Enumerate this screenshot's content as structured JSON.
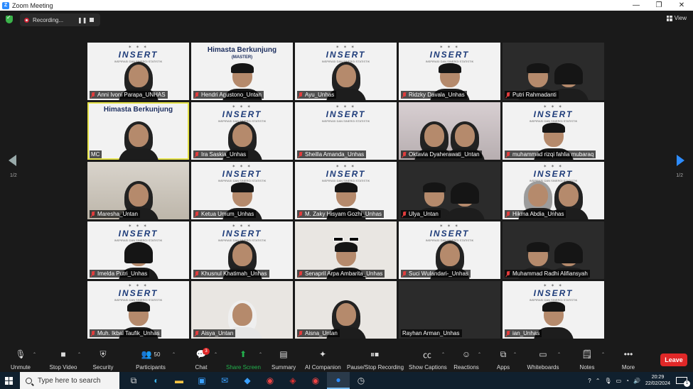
{
  "window": {
    "title": "Zoom Meeting",
    "controls": [
      "—",
      "❐",
      "✕"
    ]
  },
  "recording": {
    "label": "Recording...",
    "pause_glyph": "❚❚"
  },
  "view_button": {
    "label": "View"
  },
  "pagination": {
    "left": "1/2",
    "right": "1/2"
  },
  "tile_content": {
    "insert_logos": "✶ ✶ ✶",
    "insert_banner": "INSERT",
    "insert_sub": "INSPIRASI DAN SINERGI STATISTIK",
    "hb_title": "Himasta Berkunjung",
    "hb_master": "(MASTER)"
  },
  "participants": [
    {
      "name": "Anni Ivoni Parapa_UNHAS",
      "muted": true,
      "bg": "insert",
      "figure": "hijab-dark"
    },
    {
      "name": "Hendri Agustono_Untan",
      "muted": true,
      "bg": "himasta",
      "figure": "man"
    },
    {
      "name": "Ayu_Unhas",
      "muted": true,
      "bg": "insert",
      "figure": "hijab-dark"
    },
    {
      "name": "Ridzky Davala_Unhas",
      "muted": true,
      "bg": "insert",
      "figure": "man"
    },
    {
      "name": "Putri Rahmadanti",
      "muted": true,
      "bg": "dark",
      "figure": "two"
    },
    {
      "name": "MC",
      "muted": false,
      "bg": "himasta-active",
      "figure": "hijab-dark"
    },
    {
      "name": "Ira Saskia_Unhas",
      "muted": true,
      "bg": "insert",
      "figure": "hijab-dark"
    },
    {
      "name": "Sheilla Amanda_Unhas",
      "muted": true,
      "bg": "insert",
      "figure": "none"
    },
    {
      "name": "Oktavia Dyaherawati_Untan",
      "muted": true,
      "bg": "pink",
      "figure": "two-hijab"
    },
    {
      "name": "muhammad rizqi fahlia mubaraq",
      "muted": true,
      "bg": "insert",
      "figure": "man"
    },
    {
      "name": "Maresha_Untan",
      "muted": true,
      "bg": "room",
      "figure": "hijab-dark"
    },
    {
      "name": "Ketua Umum_Unhas",
      "muted": true,
      "bg": "insert",
      "figure": "man"
    },
    {
      "name": "M. Zaky Hisyam Gozhi_Unhas",
      "muted": true,
      "bg": "insert",
      "figure": "man"
    },
    {
      "name": "Ulya_Untan",
      "muted": true,
      "bg": "dark",
      "figure": "two"
    },
    {
      "name": "Hikma Abdia_Unhas",
      "muted": true,
      "bg": "insert",
      "figure": "two-hijab"
    },
    {
      "name": "Imelda Putri_Unhas",
      "muted": true,
      "bg": "insert",
      "figure": "woman"
    },
    {
      "name": "Khusnul Khatimah_Unhas",
      "muted": true,
      "bg": "insert",
      "figure": "hijab-dark"
    },
    {
      "name": "Senapril Arpa Ambarita_Unhas",
      "muted": true,
      "bg": "light",
      "figure": "sunglasses"
    },
    {
      "name": "Suci Wulandari-_Unhas",
      "muted": true,
      "bg": "insert",
      "figure": "hijab-dark"
    },
    {
      "name": "Muhammad Radhi Alifiansyah",
      "muted": true,
      "bg": "dark",
      "figure": "two"
    },
    {
      "name": "Muh. Ikbal Taufik_Unhas",
      "muted": true,
      "bg": "insert",
      "figure": "man"
    },
    {
      "name": "Aisya_Untan",
      "muted": true,
      "bg": "light",
      "figure": "hijab-white"
    },
    {
      "name": "Aisna_Untan",
      "muted": true,
      "bg": "light",
      "figure": "hijab-dark"
    },
    {
      "name": "Rayhan Arman_Unhas",
      "muted": false,
      "bg": "dark",
      "figure": "none"
    },
    {
      "name": "ian_Unhas",
      "muted": true,
      "bg": "insert",
      "figure": "man"
    }
  ],
  "toolbar": {
    "unmute": "Unmute",
    "stop_video": "Stop Video",
    "security": "Security",
    "participants": "Participants",
    "participants_count": "50",
    "chat": "Chat",
    "chat_badge": "3",
    "share_screen": "Share Screen",
    "summary": "Summary",
    "ai_companion": "AI Companion",
    "pause_stop_recording": "Pause/Stop Recording",
    "show_captions": "Show Captions",
    "reactions": "Reactions",
    "apps": "Apps",
    "whiteboards": "Whiteboards",
    "notes": "Notes",
    "more": "More",
    "leave": "Leave",
    "caret": "⌃"
  },
  "taskbar": {
    "search_placeholder": "Type here to search",
    "time": "20:29",
    "date": "22/02/2024",
    "notif_count": "1"
  },
  "colors": {
    "accent": "#2d8cff",
    "leave": "#e02828",
    "share": "#23b14d",
    "active_border": "#e6e34a",
    "muted_mic": "#e13d3d"
  },
  "icons": {
    "unmute": "mic-off-icon",
    "stop_video": "camera-icon",
    "security": "shield-icon",
    "participants": "people-icon",
    "chat": "chat-icon",
    "share_screen": "share-icon",
    "summary": "document-icon",
    "ai_companion": "sparkle-icon",
    "recording": "pause-stop-icon",
    "captions": "cc-icon",
    "reactions": "smiley-icon",
    "apps": "apps-icon",
    "whiteboards": "whiteboard-icon",
    "notes": "notes-icon",
    "more": "more-icon"
  }
}
